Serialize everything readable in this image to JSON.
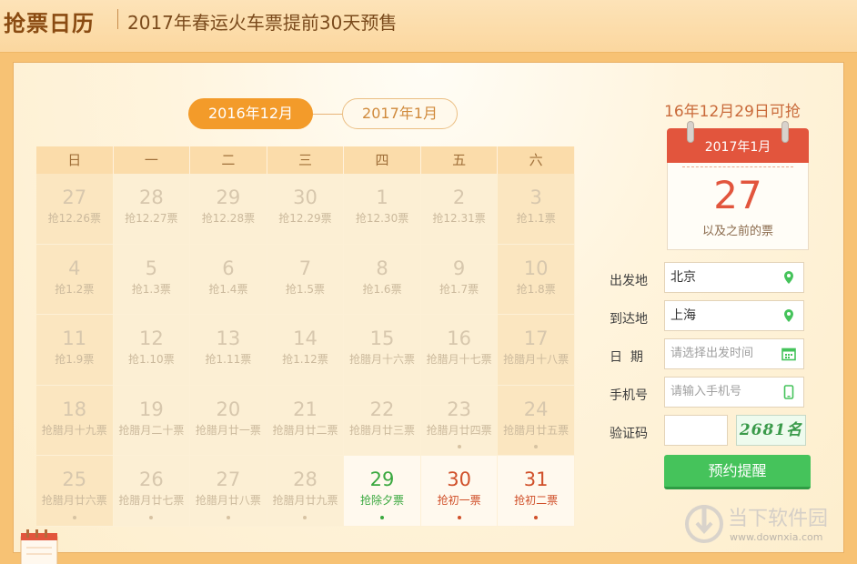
{
  "header": {
    "logo": "抢票日历",
    "title": "2017年春运火车票提前30天预售"
  },
  "tabs": [
    {
      "label": "2016年12月",
      "active": true
    },
    {
      "label": "2017年1月",
      "active": false
    }
  ],
  "weekdays": [
    "日",
    "一",
    "二",
    "三",
    "四",
    "五",
    "六"
  ],
  "calendar": [
    [
      {
        "day": "27",
        "sub": "抢12.26票"
      },
      {
        "day": "28",
        "sub": "抢12.27票"
      },
      {
        "day": "29",
        "sub": "抢12.28票"
      },
      {
        "day": "30",
        "sub": "抢12.29票"
      },
      {
        "day": "1",
        "sub": "抢12.30票"
      },
      {
        "day": "2",
        "sub": "抢12.31票"
      },
      {
        "day": "3",
        "sub": "抢1.1票"
      }
    ],
    [
      {
        "day": "4",
        "sub": "抢1.2票"
      },
      {
        "day": "5",
        "sub": "抢1.3票"
      },
      {
        "day": "6",
        "sub": "抢1.4票"
      },
      {
        "day": "7",
        "sub": "抢1.5票"
      },
      {
        "day": "8",
        "sub": "抢1.6票"
      },
      {
        "day": "9",
        "sub": "抢1.7票"
      },
      {
        "day": "10",
        "sub": "抢1.8票"
      }
    ],
    [
      {
        "day": "11",
        "sub": "抢1.9票"
      },
      {
        "day": "12",
        "sub": "抢1.10票"
      },
      {
        "day": "13",
        "sub": "抢1.11票"
      },
      {
        "day": "14",
        "sub": "抢1.12票"
      },
      {
        "day": "15",
        "sub": "抢腊月十六票"
      },
      {
        "day": "16",
        "sub": "抢腊月十七票"
      },
      {
        "day": "17",
        "sub": "抢腊月十八票"
      }
    ],
    [
      {
        "day": "18",
        "sub": "抢腊月十九票"
      },
      {
        "day": "19",
        "sub": "抢腊月二十票"
      },
      {
        "day": "20",
        "sub": "抢腊月廿一票"
      },
      {
        "day": "21",
        "sub": "抢腊月廿二票"
      },
      {
        "day": "22",
        "sub": "抢腊月廿三票"
      },
      {
        "day": "23",
        "sub": "抢腊月廿四票",
        "dot": true
      },
      {
        "day": "24",
        "sub": "抢腊月廿五票",
        "dot": true
      }
    ],
    [
      {
        "day": "25",
        "sub": "抢腊月廿六票",
        "dot": true
      },
      {
        "day": "26",
        "sub": "抢腊月廿七票",
        "dot": true
      },
      {
        "day": "27",
        "sub": "抢腊月廿八票",
        "dot": true
      },
      {
        "day": "28",
        "sub": "抢腊月廿九票",
        "dot": true
      },
      {
        "day": "29",
        "sub": "抢除夕票",
        "dot": true,
        "state": "green"
      },
      {
        "day": "30",
        "sub": "抢初一票",
        "dot": true,
        "state": "red"
      },
      {
        "day": "31",
        "sub": "抢初二票",
        "dot": true,
        "state": "red"
      }
    ]
  ],
  "side": {
    "note": "16年12月29日可抢",
    "ticket_month": "2017年1月",
    "ticket_day": "27",
    "ticket_caption": "以及之前的票"
  },
  "form": {
    "from_label": "出发地",
    "from_value": "北京",
    "to_label": "到达地",
    "to_value": "上海",
    "date_label": "日  期",
    "date_placeholder": "请选择出发时间",
    "phone_label": "手机号",
    "phone_placeholder": "请输入手机号",
    "captcha_label": "验证码",
    "captcha_text": "2681名",
    "submit_label": "预约提醒"
  },
  "watermark": {
    "cn": "当下软件园",
    "en": "www.downxia.com"
  },
  "colors": {
    "accent": "#f39b2a",
    "green": "#45c35b",
    "red": "#e2553d"
  }
}
